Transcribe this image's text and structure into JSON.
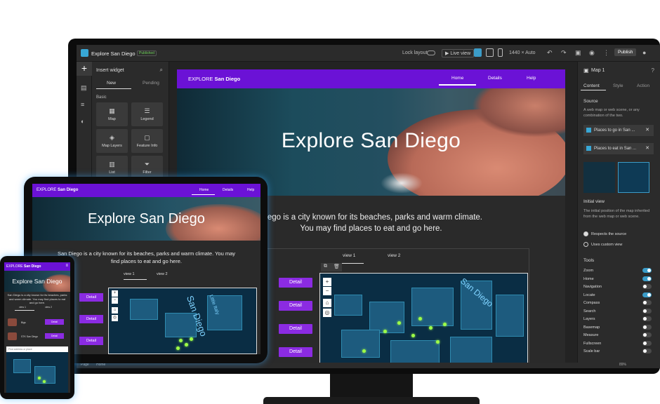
{
  "builder": {
    "app_title": "Explore San Diego",
    "status_badge": "Published",
    "lock_layout_label": "Lock layout",
    "live_view_label": "Live view",
    "screen_size": "1440 × Auto",
    "publish_label": "Publish",
    "insert_widget_title": "Insert widget",
    "tab_new": "New",
    "tab_pending": "Pending",
    "basic_label": "Basic",
    "widgets": [
      {
        "label": "Map",
        "icon": "map-icon"
      },
      {
        "label": "Legend",
        "icon": "legend-icon"
      },
      {
        "label": "Map Layers",
        "icon": "layers-icon"
      },
      {
        "label": "Feature Info",
        "icon": "info-icon"
      },
      {
        "label": "List",
        "icon": "list-icon"
      },
      {
        "label": "Filter",
        "icon": "filter-icon"
      }
    ],
    "bottom_left": "Page",
    "bottom_mid": "Home",
    "zoom_value": "89%"
  },
  "site": {
    "brand_prefix": "EXPLORE",
    "brand_name": "San Diego",
    "nav": [
      "Home",
      "Details",
      "Help"
    ],
    "hero_title": "Explore San Diego",
    "desc_line1": "San Diego is a city known for its beaches, parks and warm climate.",
    "desc_line2": "You may find places to eat and go here.",
    "desc_visible1": "Diego is a city known for its beaches, parks and warm climate.",
    "views": [
      "view 1",
      "view 2"
    ],
    "detail_label": "Detail",
    "map_label_1": "Little Italy",
    "map_label_2": "San Diego"
  },
  "settings": {
    "panel_title": "Map 1",
    "tabs": [
      "Content",
      "Style",
      "Action"
    ],
    "source_label": "Source",
    "source_desc": "A web map or web scene, or any combination of the two.",
    "source_items": [
      "Places to go in San ...",
      "Places to eat in San ..."
    ],
    "initial_view_label": "Initial view",
    "initial_view_desc": "The initial position of the map inherited from the web map or web scene.",
    "radio_1": "Respects the source",
    "radio_2": "Uses custom view",
    "tools_label": "Tools",
    "tools": [
      {
        "name": "Zoom",
        "on": true
      },
      {
        "name": "Home",
        "on": true
      },
      {
        "name": "Navigation",
        "on": false
      },
      {
        "name": "Locate",
        "on": true
      },
      {
        "name": "Compass",
        "on": false
      },
      {
        "name": "Search",
        "on": false
      },
      {
        "name": "Layers",
        "on": false
      },
      {
        "name": "Basemap",
        "on": false
      },
      {
        "name": "Measure",
        "on": false
      },
      {
        "name": "Fullscreen",
        "on": false
      },
      {
        "name": "Scale bar",
        "on": false
      }
    ]
  },
  "phone": {
    "items": [
      "Bigs",
      "STK San Diego"
    ],
    "search_placeholder": "Find address or place"
  },
  "colors": {
    "header_purple": "#6b12d6",
    "button_purple": "#8b2be2",
    "accent_blue": "#3b9cc8",
    "pin_green": "#9eff47"
  }
}
